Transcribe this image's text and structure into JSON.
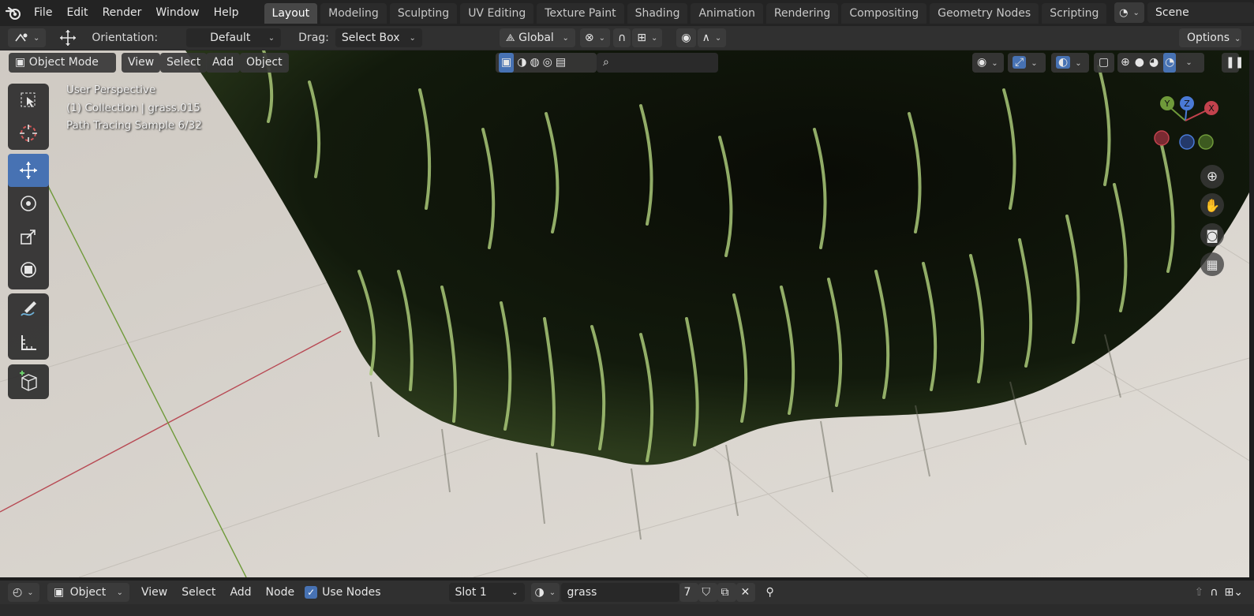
{
  "topbar": {
    "logo_icon": "blender-logo-icon",
    "menus": [
      "File",
      "Edit",
      "Render",
      "Window",
      "Help"
    ],
    "workspaces": [
      "Layout",
      "Modeling",
      "Sculpting",
      "UV Editing",
      "Texture Paint",
      "Shading",
      "Animation",
      "Rendering",
      "Compositing",
      "Geometry Nodes",
      "Scripting"
    ],
    "active_workspace": "Layout",
    "add_workspace": "+",
    "scene_name": "Scene"
  },
  "tool_settings": {
    "orientation_label": "Orientation:",
    "orientation_value": "Default",
    "drag_label": "Drag:",
    "drag_value": "Select Box",
    "transform_orientation": "Global",
    "options_label": "Options"
  },
  "viewport": {
    "mode": "Object Mode",
    "header_menus": [
      "View",
      "Select",
      "Add",
      "Object"
    ],
    "info_lines": [
      "User Perspective",
      "(1) Collection | grass.015",
      "Path Tracing Sample 6/32"
    ],
    "gizmo_axes": [
      "Y",
      "Z",
      "X"
    ],
    "tools": [
      "select-box-icon",
      "cursor-icon",
      "move-icon",
      "rotate-icon",
      "scale-icon",
      "transform-icon",
      "annotate-icon",
      "measure-icon",
      "add-cube-icon"
    ],
    "active_tool": "move-icon",
    "colors": {
      "floor": "#d9d5cf",
      "grass_dark": "#0b0f08",
      "grass_light": "#b7d48a",
      "x_axis": "#b84a54",
      "y_axis": "#6f9a3a",
      "active_blue": "#4772b3"
    }
  },
  "shader_editor_header": {
    "editor_type": "Object",
    "menus": [
      "View",
      "Select",
      "Add",
      "Node"
    ],
    "use_nodes_label": "Use Nodes",
    "use_nodes_checked": true,
    "slot": "Slot 1",
    "material_name": "grass",
    "material_users": "7"
  }
}
